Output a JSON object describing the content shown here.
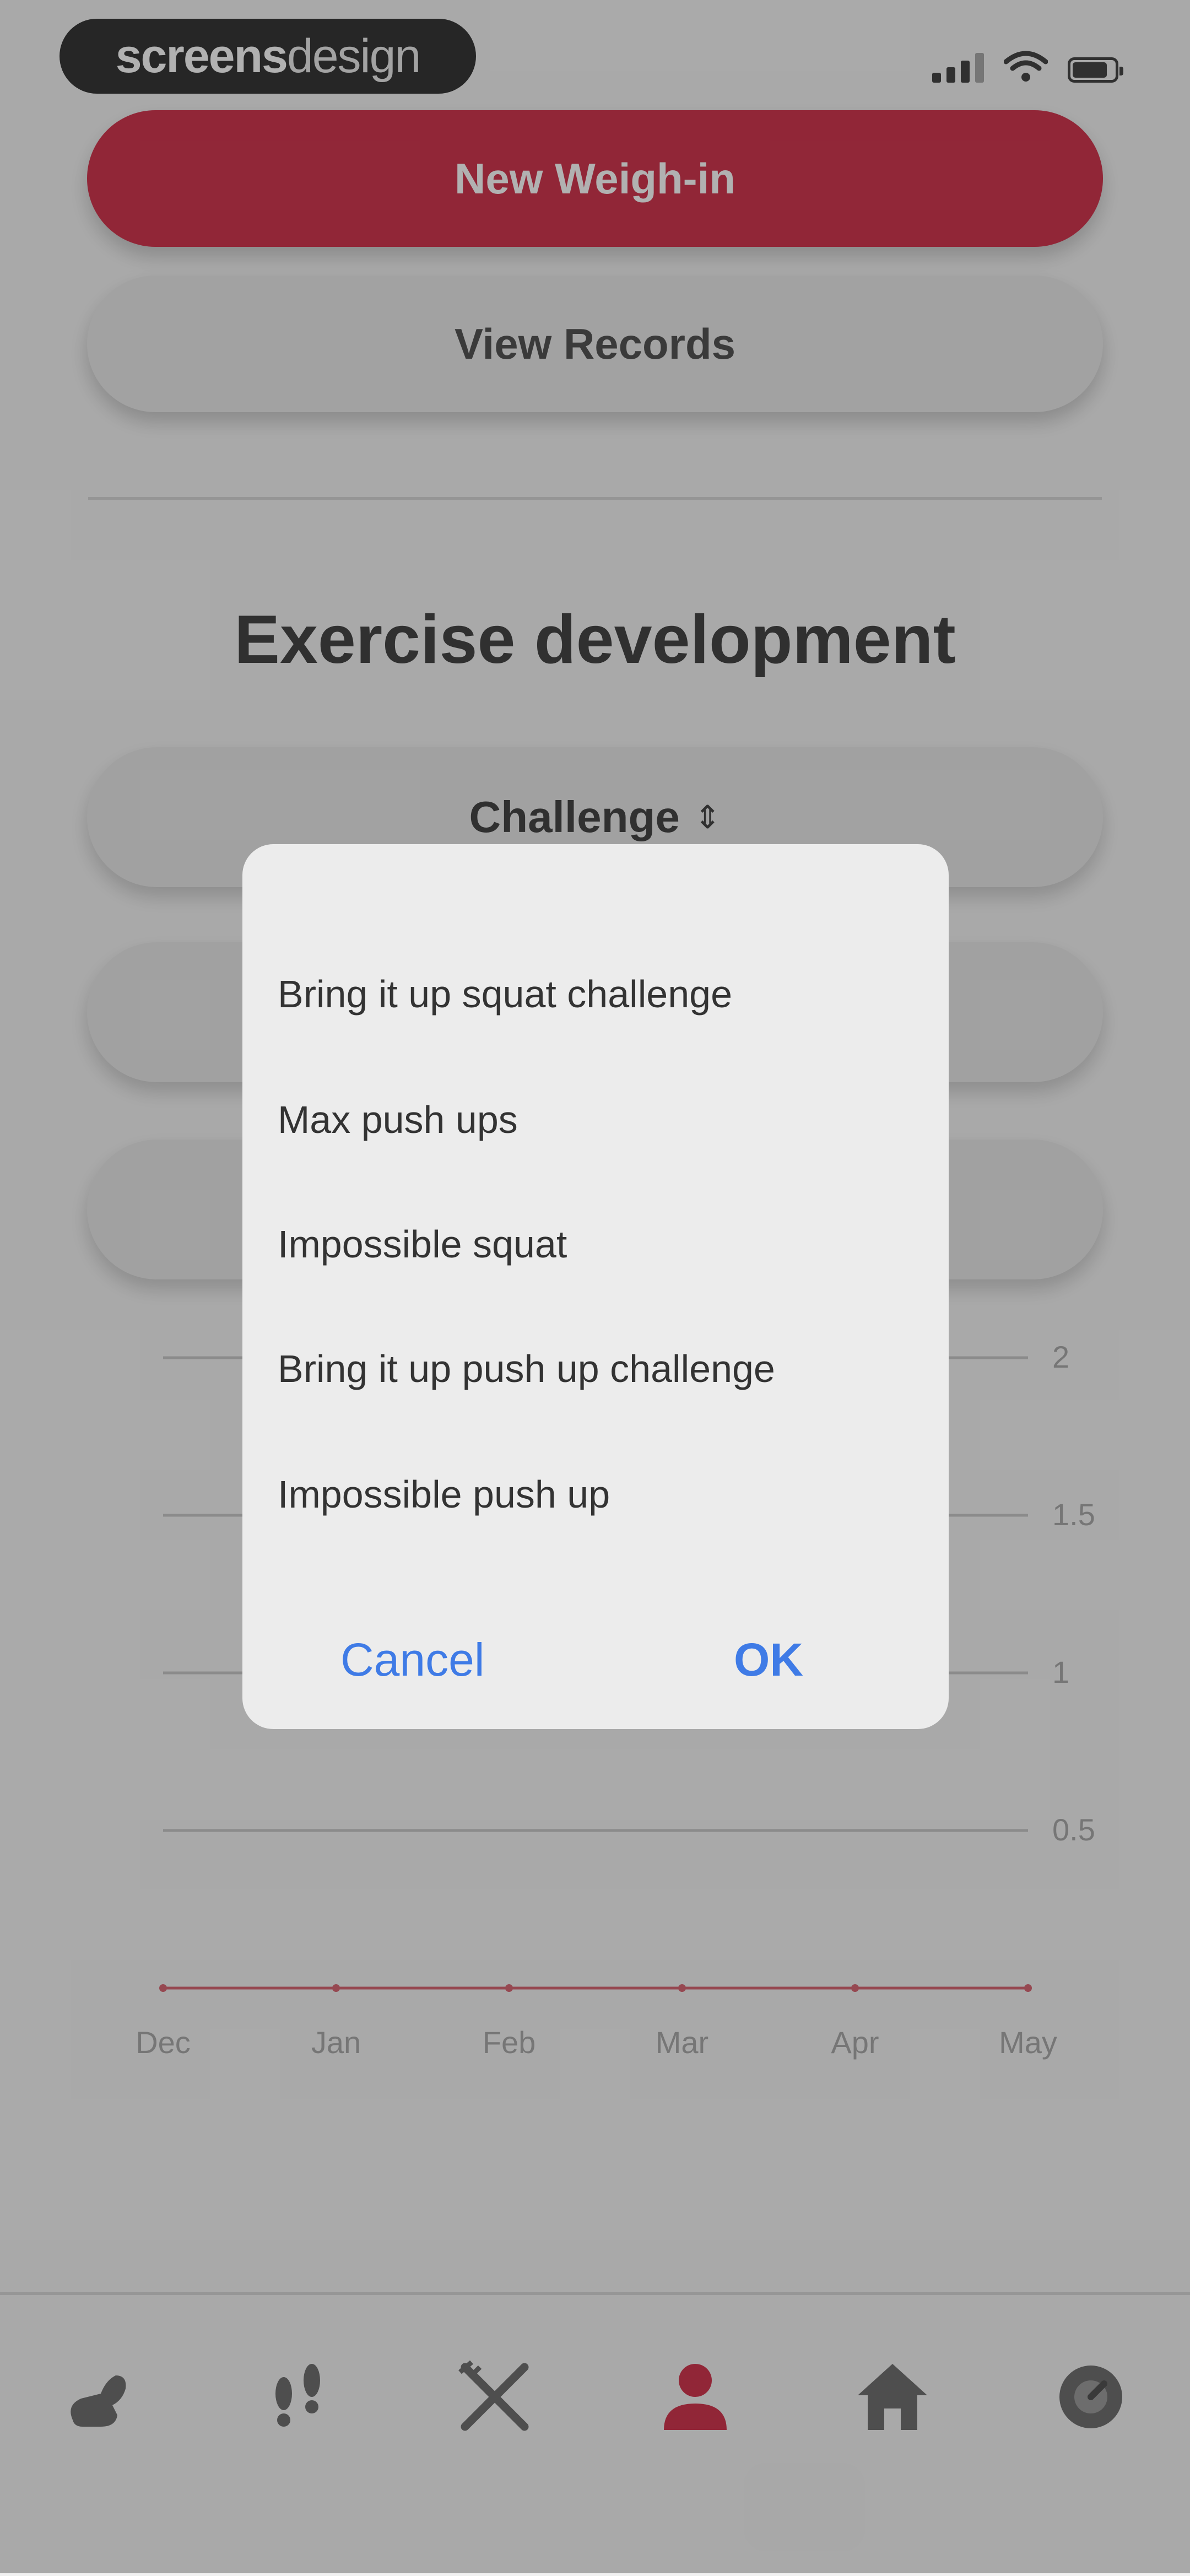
{
  "status_bar": {
    "brand_bold": "screens",
    "brand_light": "design"
  },
  "actions": {
    "new_weigh_in": "New Weigh-in",
    "view_records": "View Records"
  },
  "section": {
    "title": "Exercise development"
  },
  "selects": {
    "exercise_type": "Challenge",
    "chevron": "⇕"
  },
  "chart_data": {
    "type": "line",
    "categories": [
      "Dec",
      "Jan",
      "Feb",
      "Mar",
      "Apr",
      "May"
    ],
    "y_ticks": [
      "2",
      "1.5",
      "1",
      "0.5"
    ],
    "ylim": [
      0,
      2
    ],
    "series": [
      {
        "values": [
          0,
          0,
          0,
          0,
          0,
          0
        ]
      }
    ],
    "series_color": "#d04a5a",
    "grid": true
  },
  "dialog": {
    "options": [
      "Bring it up squat challenge",
      "Max push ups",
      "Impossible squat",
      "Bring it up push up challenge",
      "Impossible push up"
    ],
    "cancel_label": "Cancel",
    "ok_label": "OK"
  },
  "tabbar": {
    "items": [
      "strength-icon",
      "footsteps-icon",
      "fork-knife-icon",
      "profile-icon",
      "home-icon",
      "dial-icon"
    ],
    "active": "profile-icon",
    "active_color": "#c8102e"
  },
  "colors": {
    "accent": "#c8102e",
    "link": "#3f7be6"
  }
}
